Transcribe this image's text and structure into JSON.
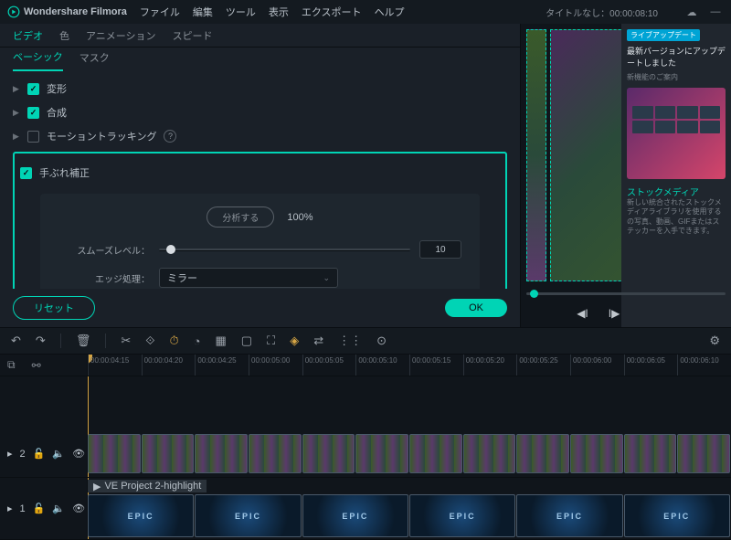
{
  "app": {
    "name": "Wondershare Filmora"
  },
  "menu": [
    "ファイル",
    "編集",
    "ツール",
    "表示",
    "エクスポート",
    "ヘルプ"
  ],
  "project": {
    "label": "タイトルなし：00:00:08:10"
  },
  "tabs1": [
    "ビデオ",
    "色",
    "アニメーション",
    "スピード"
  ],
  "tabs2": [
    "ベーシック",
    "マスク"
  ],
  "rows": {
    "transform": "変形",
    "composite": "合成",
    "motion": "モーショントラッキング",
    "stabilize": "手ぶれ補正"
  },
  "stab": {
    "analyze": "分析する",
    "pct": "100%",
    "smooth_label": "スムーズレベル：",
    "smooth_val": "10",
    "edge_label": "エッジ処理：",
    "edge_val": "ミラー"
  },
  "buttons": {
    "reset": "リセット",
    "ok": "OK"
  },
  "ad": {
    "tag": "ライブアップデート",
    "head": "最新バージョンにアップデートしました",
    "sub": "新機能のご案内",
    "title": "ストックメディア",
    "desc": "新しい統合されたストックメディアライブラリを使用するの写真、動画、GIFまたはステッカーを入手できます。"
  },
  "ruler": [
    "00:00:04:15",
    "00:00:04:20",
    "00:00:04:25",
    "00:00:05:00",
    "00:00:05:05",
    "00:00:05:10",
    "00:00:05:15",
    "00:00:05:20",
    "00:00:05:25",
    "00:00:06:00",
    "00:00:06:05",
    "00:00:06:10"
  ],
  "tracks": {
    "t2": "2",
    "t1": "1"
  },
  "clip_label": "VE Project 2-highlight",
  "epic": "EPIC"
}
